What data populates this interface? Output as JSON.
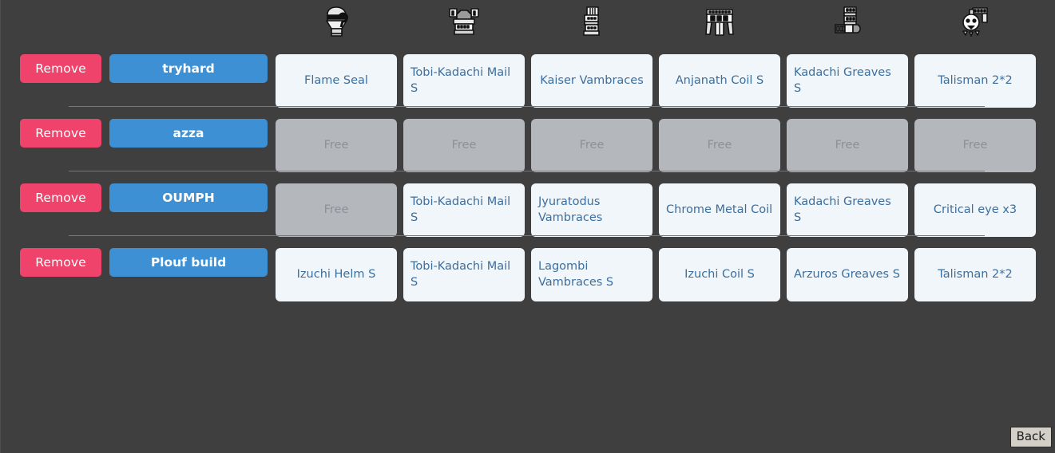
{
  "window": {
    "background_color": "#3f3f3f",
    "accent_blue": "#3d90d4",
    "accent_red": "#f0436b",
    "card_color": "#f1f6fa",
    "card_text_color": "#3c6e9e",
    "free_card_color": "#b4b8bd",
    "free_card_text_color": "#8b9199"
  },
  "header": {
    "slot_icons": [
      {
        "name": "helmet-icon",
        "label": "Head"
      },
      {
        "name": "chest-armor-icon",
        "label": "Chest"
      },
      {
        "name": "gauntlets-icon",
        "label": "Arms"
      },
      {
        "name": "waist-coil-icon",
        "label": "Waist"
      },
      {
        "name": "greaves-icon",
        "label": "Legs"
      },
      {
        "name": "talisman-icon",
        "label": "Talisman"
      }
    ]
  },
  "builds": [
    {
      "remove_label": "Remove",
      "name": "tryhard",
      "slots": [
        {
          "label": "Flame Seal",
          "free": false
        },
        {
          "label": "Tobi-Kadachi Mail S",
          "free": false
        },
        {
          "label": "Kaiser Vambraces",
          "free": false
        },
        {
          "label": "Anjanath Coil S",
          "free": false
        },
        {
          "label": "Kadachi Greaves S",
          "free": false
        },
        {
          "label": "Talisman 2*2",
          "free": false
        }
      ]
    },
    {
      "remove_label": "Remove",
      "name": "azza",
      "slots": [
        {
          "label": "Free",
          "free": true
        },
        {
          "label": "Free",
          "free": true
        },
        {
          "label": "Free",
          "free": true
        },
        {
          "label": "Free",
          "free": true
        },
        {
          "label": "Free",
          "free": true
        },
        {
          "label": "Free",
          "free": true
        }
      ]
    },
    {
      "remove_label": "Remove",
      "name": "OUMPH",
      "slots": [
        {
          "label": "Free",
          "free": true
        },
        {
          "label": "Tobi-Kadachi Mail S",
          "free": false
        },
        {
          "label": "Jyuratodus Vambraces",
          "free": false
        },
        {
          "label": "Chrome Metal Coil",
          "free": false
        },
        {
          "label": "Kadachi Greaves S",
          "free": false
        },
        {
          "label": "Critical eye x3",
          "free": false
        }
      ]
    },
    {
      "remove_label": "Remove",
      "name": "Plouf build",
      "slots": [
        {
          "label": "Izuchi Helm S",
          "free": false
        },
        {
          "label": "Tobi-Kadachi Mail S",
          "free": false
        },
        {
          "label": "Lagombi Vambraces S",
          "free": false
        },
        {
          "label": "Izuchi Coil S",
          "free": false
        },
        {
          "label": "Arzuros Greaves S",
          "free": false
        },
        {
          "label": "Talisman 2*2",
          "free": false
        }
      ]
    }
  ],
  "footer": {
    "back_label": "Back"
  }
}
